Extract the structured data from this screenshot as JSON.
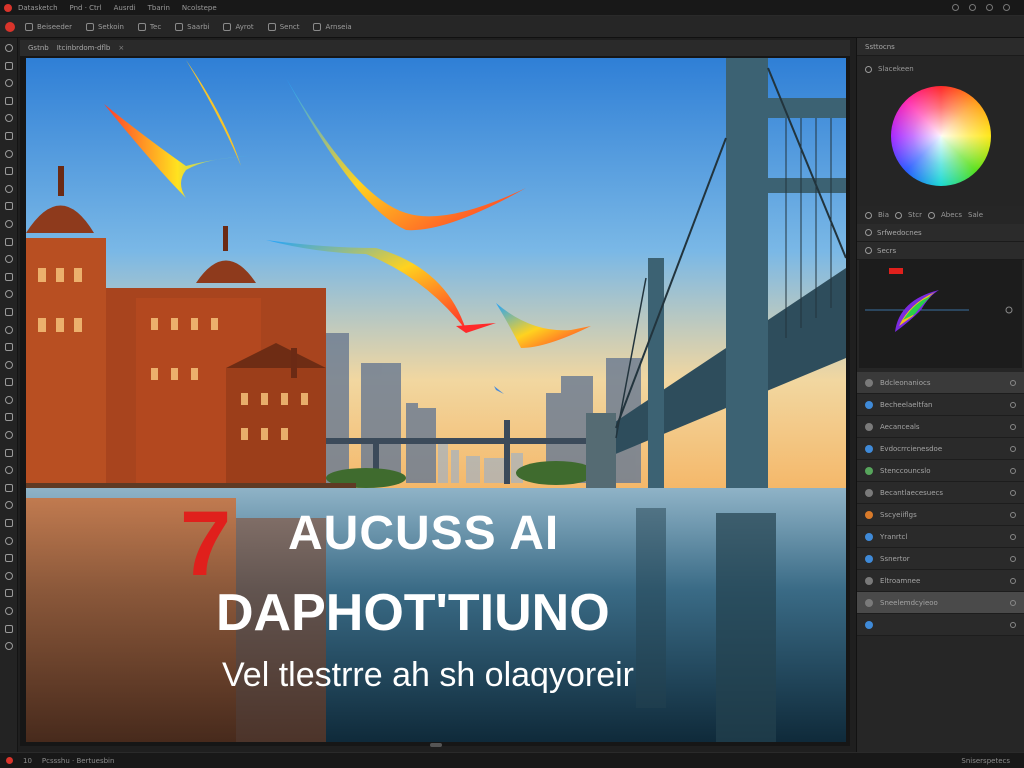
{
  "menubar": {
    "items": [
      "Datasketch",
      "Pnd · Ctrl",
      "Ausrdi",
      "Tbarin",
      "Ncolstepe"
    ]
  },
  "optionsbar": {
    "options": [
      "Beiseeder",
      "Setkoin",
      "Tec",
      "Saarbi",
      "Ayrot",
      "Senct",
      "Arnseia"
    ]
  },
  "document": {
    "tab_label": "Gstnb",
    "tab_subtitle": "Itcinbrdom-dflb"
  },
  "canvas_text": {
    "badge": "7",
    "headline_line1": "AUCUSS AI",
    "headline_line2": "DAPHOT'TIUNO",
    "subline": "Vel tlestrre ah sh olaqyoreir"
  },
  "panels": {
    "color_header": "Ssttocns",
    "color_label": "Slacekeen",
    "wheel_row": [
      "Bia",
      "Stcr",
      "Abecs",
      "Sale"
    ],
    "adjust_header": "Srfwedocnes",
    "curves_header": "Secrs",
    "layers": [
      {
        "label": "Bdcleonaniocs",
        "color": "#7a7a7a"
      },
      {
        "label": "Becheelaeltfan",
        "color": "#3f8ad8"
      },
      {
        "label": "Aecanceals",
        "color": "#7a7a7a"
      },
      {
        "label": "Evdocrrcienesdoe",
        "color": "#3f8ad8"
      },
      {
        "label": "Stenccouncslo",
        "color": "#57a55c"
      },
      {
        "label": "Becantlaecesuecs",
        "color": "#7a7a7a"
      },
      {
        "label": "Sscyeiiflgs",
        "color": "#d87a2a"
      },
      {
        "label": "Yranrtcl",
        "color": "#3f8ad8"
      },
      {
        "label": "Ssnertor",
        "color": "#3f8ad8"
      },
      {
        "label": "Eltroamnee",
        "color": "#7a7a7a"
      },
      {
        "label": "Sneelemdcyieoo",
        "color": "#7a7a7a"
      },
      {
        "label": "",
        "color": "#3f8ad8"
      }
    ]
  },
  "statusbar": {
    "zoom": "10",
    "info": "Pcssshu · Bertuesbin",
    "right": "Sniserspetecs"
  },
  "colors": {
    "accent_red": "#d9342b",
    "panel_bg": "#262626",
    "active_blue": "#3f8ad8"
  }
}
